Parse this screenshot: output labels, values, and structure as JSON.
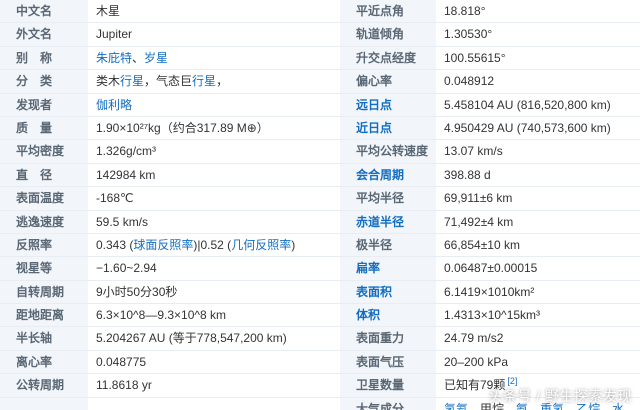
{
  "rows": [
    {
      "l_key": "中文名",
      "l_val": "木星",
      "r_key": "平近点角",
      "r_val": "18.818°"
    },
    {
      "l_key": "外文名",
      "l_val": "Jupiter",
      "r_key": "轨道倾角",
      "r_val": "1.30530°"
    },
    {
      "l_key": "别　称",
      "l_val_parts": [
        "朱庇特",
        "、",
        "岁星"
      ],
      "r_key": "升交点经度",
      "r_val": "100.55615°"
    },
    {
      "l_key": "分　类",
      "l_val_parts": [
        "类木",
        "行星",
        "，气态巨",
        "行星",
        "，"
      ],
      "r_key": "偏心率",
      "r_val": "0.048912"
    },
    {
      "l_key": "发现者",
      "l_val": "伽利略",
      "r_key": "远日点",
      "r_val": "5.458104 AU (816,520,800 km)"
    },
    {
      "l_key": "质　量",
      "l_val": "1.90×10²⁷kg（约合317.89 M⊕）",
      "r_key": "近日点",
      "r_val": "4.950429 AU (740,573,600 km)"
    },
    {
      "l_key": "平均密度",
      "l_val": "1.326g/cm³",
      "r_key": "平均公转速度",
      "r_val": "13.07 km/s"
    },
    {
      "l_key": "直　径",
      "l_val": "142984 km",
      "r_key": "会合周期",
      "r_val": "398.88 d"
    },
    {
      "l_key": "表面温度",
      "l_val": "-168℃",
      "r_key": "平均半径",
      "r_val": "69,911±6 km"
    },
    {
      "l_key": "逃逸速度",
      "l_val": "59.5 km/s",
      "r_key": "赤道半径",
      "r_val": "71,492±4 km"
    },
    {
      "l_key": "反照率",
      "l_val_parts": [
        "0.343 (",
        "球面反照率",
        ")|0.52 (",
        "几何反照率",
        ")"
      ],
      "r_key": "极半径",
      "r_val": "66,854±10 km"
    },
    {
      "l_key": "视星等",
      "l_val": "−1.60~2.94",
      "r_key": "扁率",
      "r_val": "0.06487±0.00015"
    },
    {
      "l_key": "自转周期",
      "l_val": "9小时50分30秒",
      "r_key": "表面积",
      "r_val": "6.1419×1010km²"
    },
    {
      "l_key": "距地距离",
      "l_val": "6.3×10^8—9.3×10^8 km",
      "r_key": "体积",
      "r_val": "1.4313×10^15km³"
    },
    {
      "l_key": "半长轴",
      "l_val": "5.204267 AU (等于778,547,200 km)",
      "r_key": "表面重力",
      "r_val": "24.79 m/s2"
    },
    {
      "l_key": "离心率",
      "l_val": "0.048775",
      "r_key": "表面气压",
      "r_val": "20–200 kPa"
    },
    {
      "l_key": "公转周期",
      "l_val": "11.8618 yr",
      "r_key": "卫星数量",
      "r_val": "已知有79颗",
      "r_sup": "[2]"
    },
    {
      "l_key": "",
      "l_val": "",
      "r_key": "大气成分",
      "r_val_parts": [
        "氢",
        "氦",
        "、甲烷、",
        "氨",
        "、",
        "重氢",
        "、",
        "乙烷",
        "、",
        "水"
      ]
    }
  ],
  "watermark": "头条号 / 野生探索发现"
}
